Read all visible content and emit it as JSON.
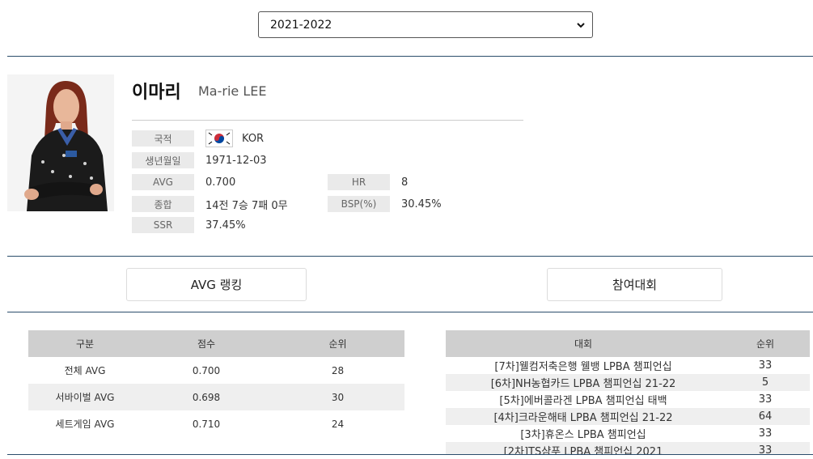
{
  "season": {
    "selected": "2021-2022"
  },
  "player": {
    "name_ko": "이마리",
    "name_en": "Ma-rie LEE",
    "photo_alt": "player-photo"
  },
  "info": {
    "nationality_label": "국적",
    "nationality_value": "KOR",
    "birth_label": "생년월일",
    "birth_value": "1971-12-03",
    "avg_label": "AVG",
    "avg_value": "0.700",
    "hr_label": "HR",
    "hr_value": "8",
    "record_label": "종합",
    "record_value": "14전 7승 7패 0무",
    "bsp_label": "BSP(%)",
    "bsp_value": "30.45%",
    "ssr_label": "SSR",
    "ssr_value": "37.45%"
  },
  "tabs": {
    "avg_ranking": "AVG 랭킹",
    "tournaments": "참여대회"
  },
  "avg_table": {
    "headers": [
      "구분",
      "점수",
      "순위"
    ],
    "rows": [
      [
        "전체 AVG",
        "0.700",
        "28"
      ],
      [
        "서바이벌 AVG",
        "0.698",
        "30"
      ],
      [
        "세트게임 AVG",
        "0.710",
        "24"
      ]
    ]
  },
  "tournament_table": {
    "headers": [
      "대회",
      "순위"
    ],
    "rows": [
      [
        "[7차]웰컴저축은행 웰뱅 LPBA 챔피언십",
        "33"
      ],
      [
        "[6차]NH농협카드 LPBA 챔피언십 21-22",
        "5"
      ],
      [
        "[5차]에버콜라겐 LPBA 챔피언십 태백",
        "33"
      ],
      [
        "[4차]크라운해태 LPBA 챔피언십 21-22",
        "64"
      ],
      [
        "[3차]휴온스 LPBA 챔피언십",
        "33"
      ],
      [
        "[2차]TS샴푸 LPBA 챔피언십 2021",
        "33"
      ]
    ]
  }
}
